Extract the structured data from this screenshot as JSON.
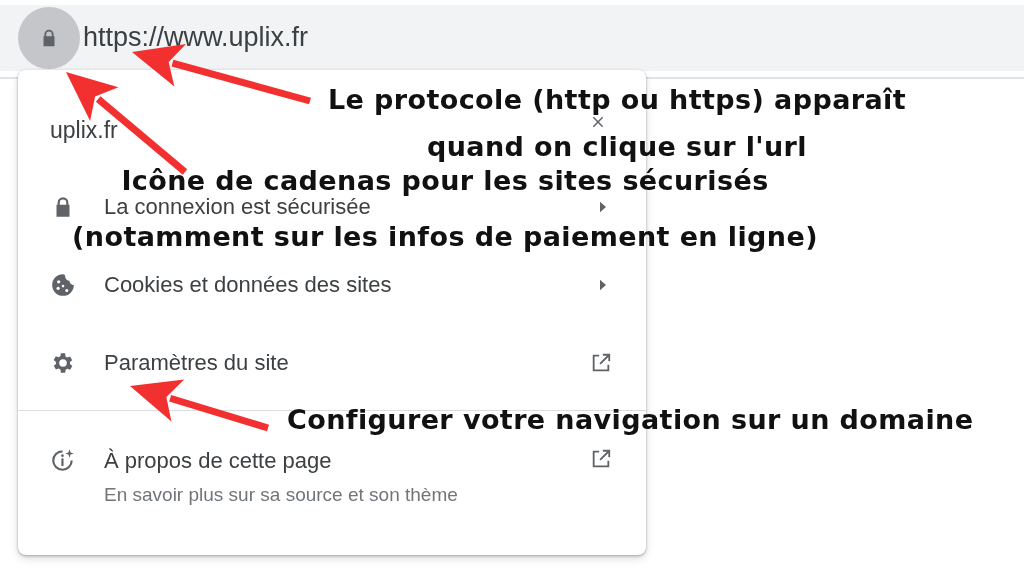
{
  "address_bar": {
    "url": "https://www.uplix.fr"
  },
  "site_info_popup": {
    "title": "uplix.fr",
    "items": [
      {
        "kind": "connection",
        "label": "La connexion est sécurisée"
      },
      {
        "kind": "cookies",
        "label": "Cookies et données des sites"
      },
      {
        "kind": "settings",
        "label": "Paramètres du site"
      },
      {
        "kind": "about",
        "label": "À propos de cette page",
        "subtitle": "En savoir plus sur sa source et son thème"
      }
    ]
  },
  "annotations": [
    {
      "lines": [
        "Le protocole (http ou https) apparaît",
        "quand on clique sur l'url"
      ]
    },
    {
      "lines": [
        "Icône de cadenas pour les sites sécurisés",
        "(notamment sur les infos de paiement en ligne)"
      ]
    },
    {
      "lines": [
        "Configurer votre navigation sur un domaine"
      ]
    }
  ]
}
